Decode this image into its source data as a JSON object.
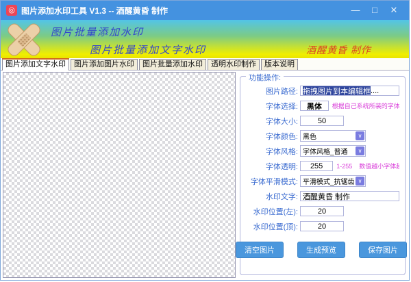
{
  "window": {
    "title": "图片添加水印工具 V1.3 -- 酒醒黄昏 制作",
    "controls": {
      "minimize": "—",
      "maximize": "□",
      "close": "✕"
    }
  },
  "banner": {
    "line1": "图片批量添加水印",
    "line2": "图片批量添加文字水印",
    "credit": "酒醒黄昏 制作"
  },
  "tabs": [
    {
      "label": "图片添加文字水印",
      "active": true
    },
    {
      "label": "图片添加图片水印",
      "active": false
    },
    {
      "label": "图片批量添加水印",
      "active": false
    },
    {
      "label": "透明水印制作",
      "active": false
    },
    {
      "label": "版本说明",
      "active": false
    }
  ],
  "panel": {
    "legend": "功能操作:",
    "fields": {
      "path": {
        "label": "图片路径:",
        "value_selected": "拖拽图片到本编辑框",
        "value_rest": "...."
      },
      "font_select": {
        "label": "字体选择:",
        "value": "黑体",
        "hint": "根据自己系统所装的字体自行输入吧。"
      },
      "font_size": {
        "label": "字体大小:",
        "value": "50"
      },
      "font_color": {
        "label": "字体颜色:",
        "value": "黑色"
      },
      "font_style": {
        "label": "字体风格:",
        "value": "字体风格_普通"
      },
      "font_alpha": {
        "label": "字体透明:",
        "value": "255",
        "hint_range": "1-255",
        "hint": "数值越小字体越透明。"
      },
      "smooth_mode": {
        "label": "字体平滑模式:",
        "value": "平滑模式_抗锯齿"
      },
      "wm_text": {
        "label": "水印文字:",
        "value": "酒醒黄昏 制作"
      },
      "pos_left": {
        "label": "水印位置(左):",
        "value": "20"
      },
      "pos_top": {
        "label": "水印位置(顶):",
        "value": "20"
      }
    },
    "buttons": {
      "clear": "清空图片",
      "preview": "生成预览",
      "save": "保存图片"
    }
  },
  "icons": {
    "app_icon_glyph": "◎",
    "dropdown_arrow": "∨"
  },
  "colors": {
    "titlebar": "#4492e0",
    "accent_button": "#4a97dd",
    "label_blue": "#3a6bd0",
    "hint_magenta": "#d93fd9",
    "dropdown_arrow_bg": "#7a7ce0",
    "active_tab_top": "#cf6a1c",
    "banner_text_blue": "#3347cc",
    "banner_credit_red": "#dd4422"
  }
}
